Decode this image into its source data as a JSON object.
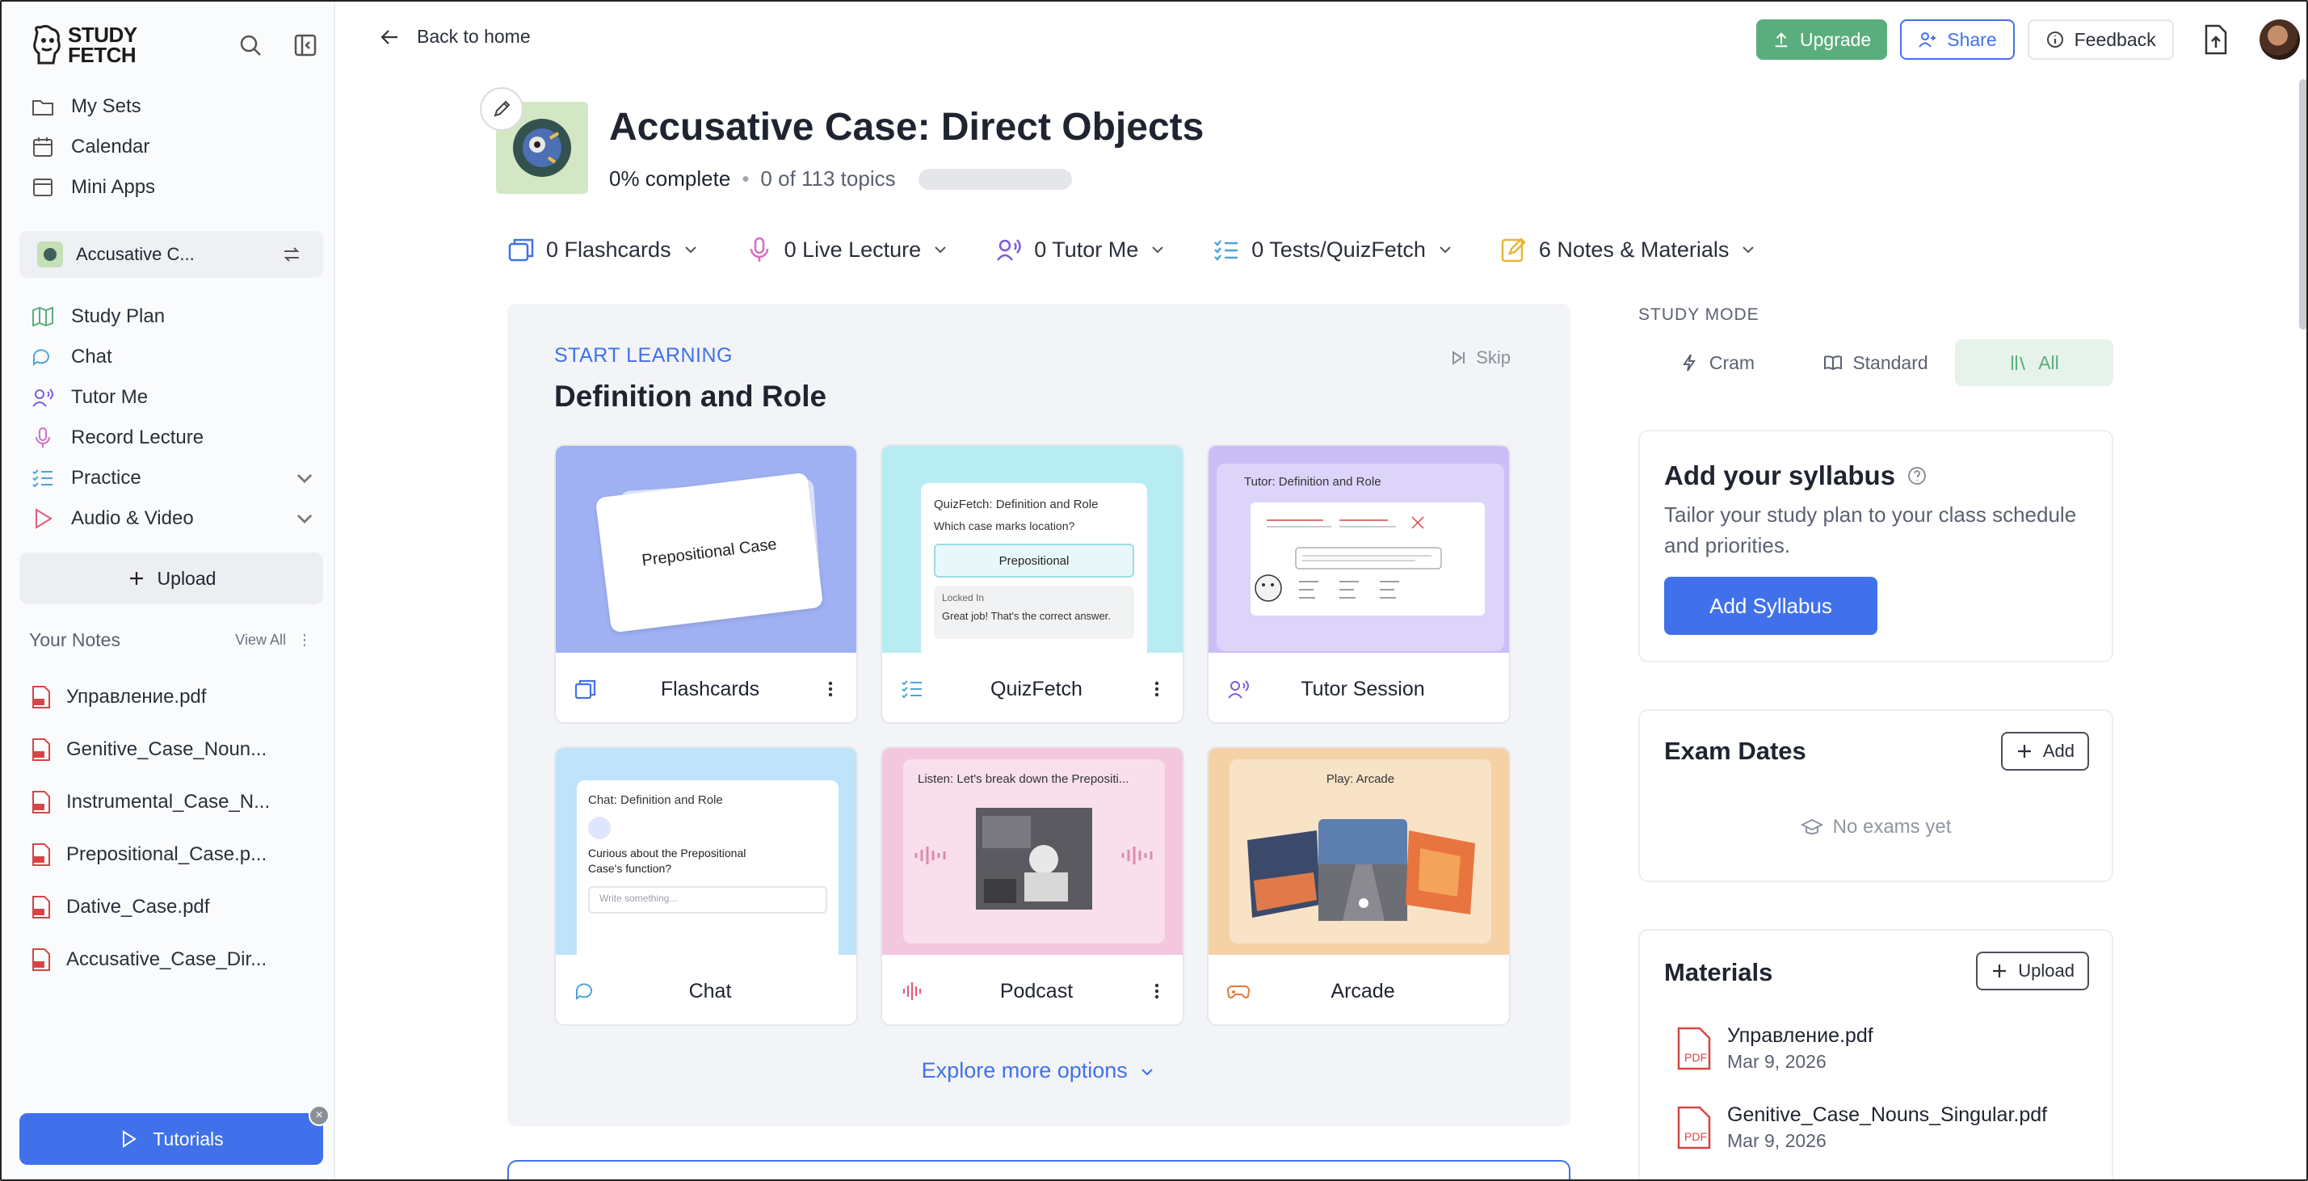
{
  "sidebar": {
    "logo_line1": "STUDY",
    "logo_line2": "FETCH",
    "nav_top": [
      "My Sets",
      "Calendar",
      "Mini Apps"
    ],
    "current_set": "Accusative C...",
    "nav_main": [
      "Study Plan",
      "Chat",
      "Tutor Me",
      "Record Lecture",
      "Practice",
      "Audio & Video"
    ],
    "upload_label": "Upload",
    "notes_heading": "Your Notes",
    "view_all": "View All",
    "notes": [
      "Управление.pdf",
      "Genitive_Case_Noun...",
      "Instrumental_Case_N...",
      "Prepositional_Case.p...",
      "Dative_Case.pdf",
      "Accusative_Case_Dir..."
    ],
    "tutorials_label": "Tutorials"
  },
  "topbar": {
    "back": "Back to home",
    "upgrade": "Upgrade",
    "share": "Share",
    "feedback": "Feedback"
  },
  "header": {
    "title": "Accusative Case: Direct Objects",
    "percent": "0% complete",
    "dot": "•",
    "topics": "0 of 113 topics",
    "progress_fraction": 0
  },
  "tools": [
    "0 Flashcards",
    "0 Live Lecture",
    "0 Tutor Me",
    "0 Tests/QuizFetch",
    "6 Notes & Materials"
  ],
  "learn": {
    "tag": "START LEARNING",
    "title": "Definition and Role",
    "skip": "Skip",
    "cards": [
      {
        "label": "Flashcards",
        "preview": "Prepositional Case"
      },
      {
        "label": "QuizFetch",
        "preview_title": "QuizFetch: Definition and Role",
        "question": "Which case marks location?",
        "answer": "Prepositional",
        "locked": "Locked In",
        "feedback": "Great job! That's the correct answer."
      },
      {
        "label": "Tutor Session",
        "preview_title": "Tutor: Definition and Role"
      },
      {
        "label": "Chat",
        "preview_title": "Chat: Definition and Role",
        "message": "Curious about the Prepositional Case's function?",
        "placeholder": "Write something..."
      },
      {
        "label": "Podcast",
        "preview_title": "Listen: Let's break down the Prepositi..."
      },
      {
        "label": "Arcade",
        "preview_title": "Play: Arcade"
      }
    ],
    "explore": "Explore more options"
  },
  "study_mode": {
    "label": "STUDY MODE",
    "modes": [
      "Cram",
      "Standard",
      "All"
    ],
    "active": "All"
  },
  "syllabus": {
    "title": "Add your syllabus",
    "desc": "Tailor your study plan to your class schedule and priorities.",
    "button": "Add Syllabus"
  },
  "exams": {
    "title": "Exam Dates",
    "add": "Add",
    "empty": "No exams yet"
  },
  "materials": {
    "title": "Materials",
    "upload": "Upload",
    "items": [
      {
        "name": "Управление.pdf",
        "date": "Mar 9, 2026"
      },
      {
        "name": "Genitive_Case_Nouns_Singular.pdf",
        "date": "Mar 9, 2026"
      }
    ]
  },
  "colors": {
    "accent": "#4171ea",
    "upgrade": "#5aae7d",
    "panel": "#f2f4f8"
  }
}
